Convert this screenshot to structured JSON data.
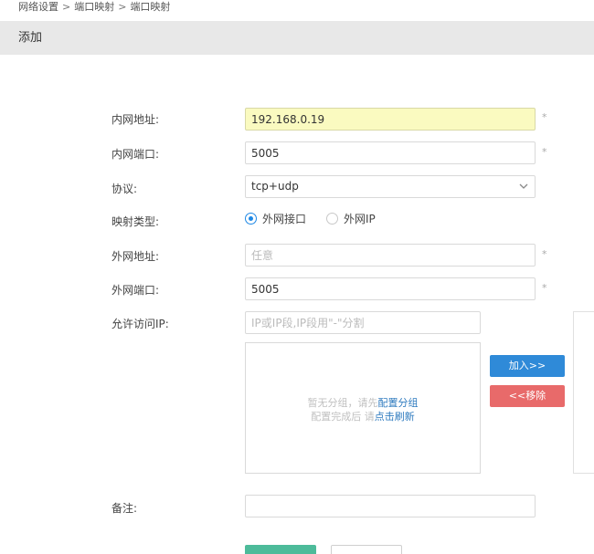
{
  "breadcrumb": [
    "网络设置",
    "端口映射",
    "端口映射"
  ],
  "breadcrumb_separator": ">",
  "section": {
    "title": "添加"
  },
  "form": {
    "lan_address": {
      "label": "内网地址:",
      "value": "192.168.0.19",
      "required_mark": "*"
    },
    "lan_port": {
      "label": "内网端口:",
      "value": "5005",
      "required_mark": "*"
    },
    "protocol": {
      "label": "协议:",
      "value": "tcp+udp"
    },
    "mapping_type": {
      "label": "映射类型:",
      "options": [
        "外网接口",
        "外网IP"
      ],
      "selected": "外网接口"
    },
    "wan_address": {
      "label": "外网地址:",
      "value": "",
      "placeholder": "任意",
      "required_mark": "*"
    },
    "wan_port": {
      "label": "外网端口:",
      "value": "5005",
      "required_mark": "*"
    },
    "allowed_ip": {
      "label": "允许访问IP:",
      "placeholder": "IP或IP段,IP段用\"-\"分割",
      "empty_line1": "暂无分组，请先",
      "empty_link1": "配置分组",
      "empty_line2": "配置完成后 请",
      "empty_link2": "点击刷新"
    },
    "add_button": "加入>>",
    "remove_button": "<<移除",
    "note": {
      "label": "备注:",
      "value": ""
    }
  },
  "colors": {
    "add": "#2f8ad8",
    "remove": "#e86a6a",
    "save": "#4dbb9a",
    "highlight": "#fafac0"
  }
}
